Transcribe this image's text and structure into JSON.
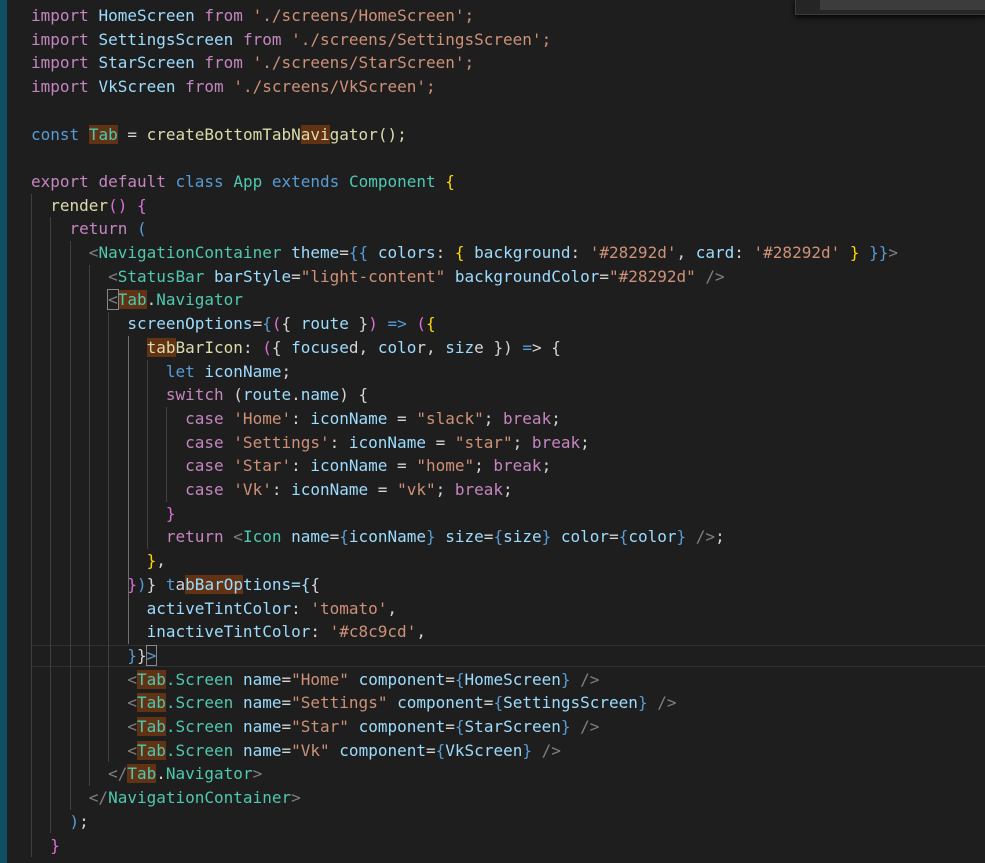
{
  "code": {
    "lines": [
      "import HomeScreen from './screens/HomeScreen';",
      "import SettingsScreen from './screens/SettingsScreen';",
      "import StarScreen from './screens/StarScreen';",
      "import VkScreen from './screens/VkScreen';",
      "",
      "const Tab = createBottomTabNavigator();",
      "",
      "export default class App extends Component {",
      "  render() {",
      "    return (",
      "      <NavigationContainer theme={{ colors: { background: '#28292d', card: '#28292d' } }}>",
      "        <StatusBar barStyle=\"light-content\" backgroundColor=\"#28292d\" />",
      "        <Tab.Navigator",
      "          screenOptions={({ route }) => ({",
      "            tabBarIcon: ({ focused, color, size }) => {",
      "              let iconName;",
      "              switch (route.name) {",
      "                case 'Home': iconName = \"slack\"; break;",
      "                case 'Settings': iconName = \"star\"; break;",
      "                case 'Star': iconName = \"home\"; break;",
      "                case 'Vk': iconName = \"vk\"; break;",
      "              }",
      "              return <Icon name={iconName} size={size} color={color} />;",
      "            },",
      "          })} tabBarOptions={{",
      "            activeTintColor: 'tomato',",
      "            inactiveTintColor: '#c8c9cd',",
      "          }}>",
      "          <Tab.Screen name=\"Home\" component={HomeScreen} />",
      "          <Tab.Screen name=\"Settings\" component={SettingsScreen} />",
      "          <Tab.Screen name=\"Star\" component={StarScreen} />",
      "          <Tab.Screen name=\"Vk\" component={VkScreen} />",
      "        </Tab.Navigator>",
      "      </NavigationContainer>",
      "    );",
      "  }"
    ]
  },
  "colors": {
    "background": "#1e1e1e",
    "keyword": "#c586c0",
    "storage": "#569cd6",
    "variable": "#9cdcfe",
    "type": "#4ec9b0",
    "string": "#ce9178",
    "function": "#dcdcaa",
    "highlight": "#613214",
    "gutter_bar": "#0e4f64"
  }
}
